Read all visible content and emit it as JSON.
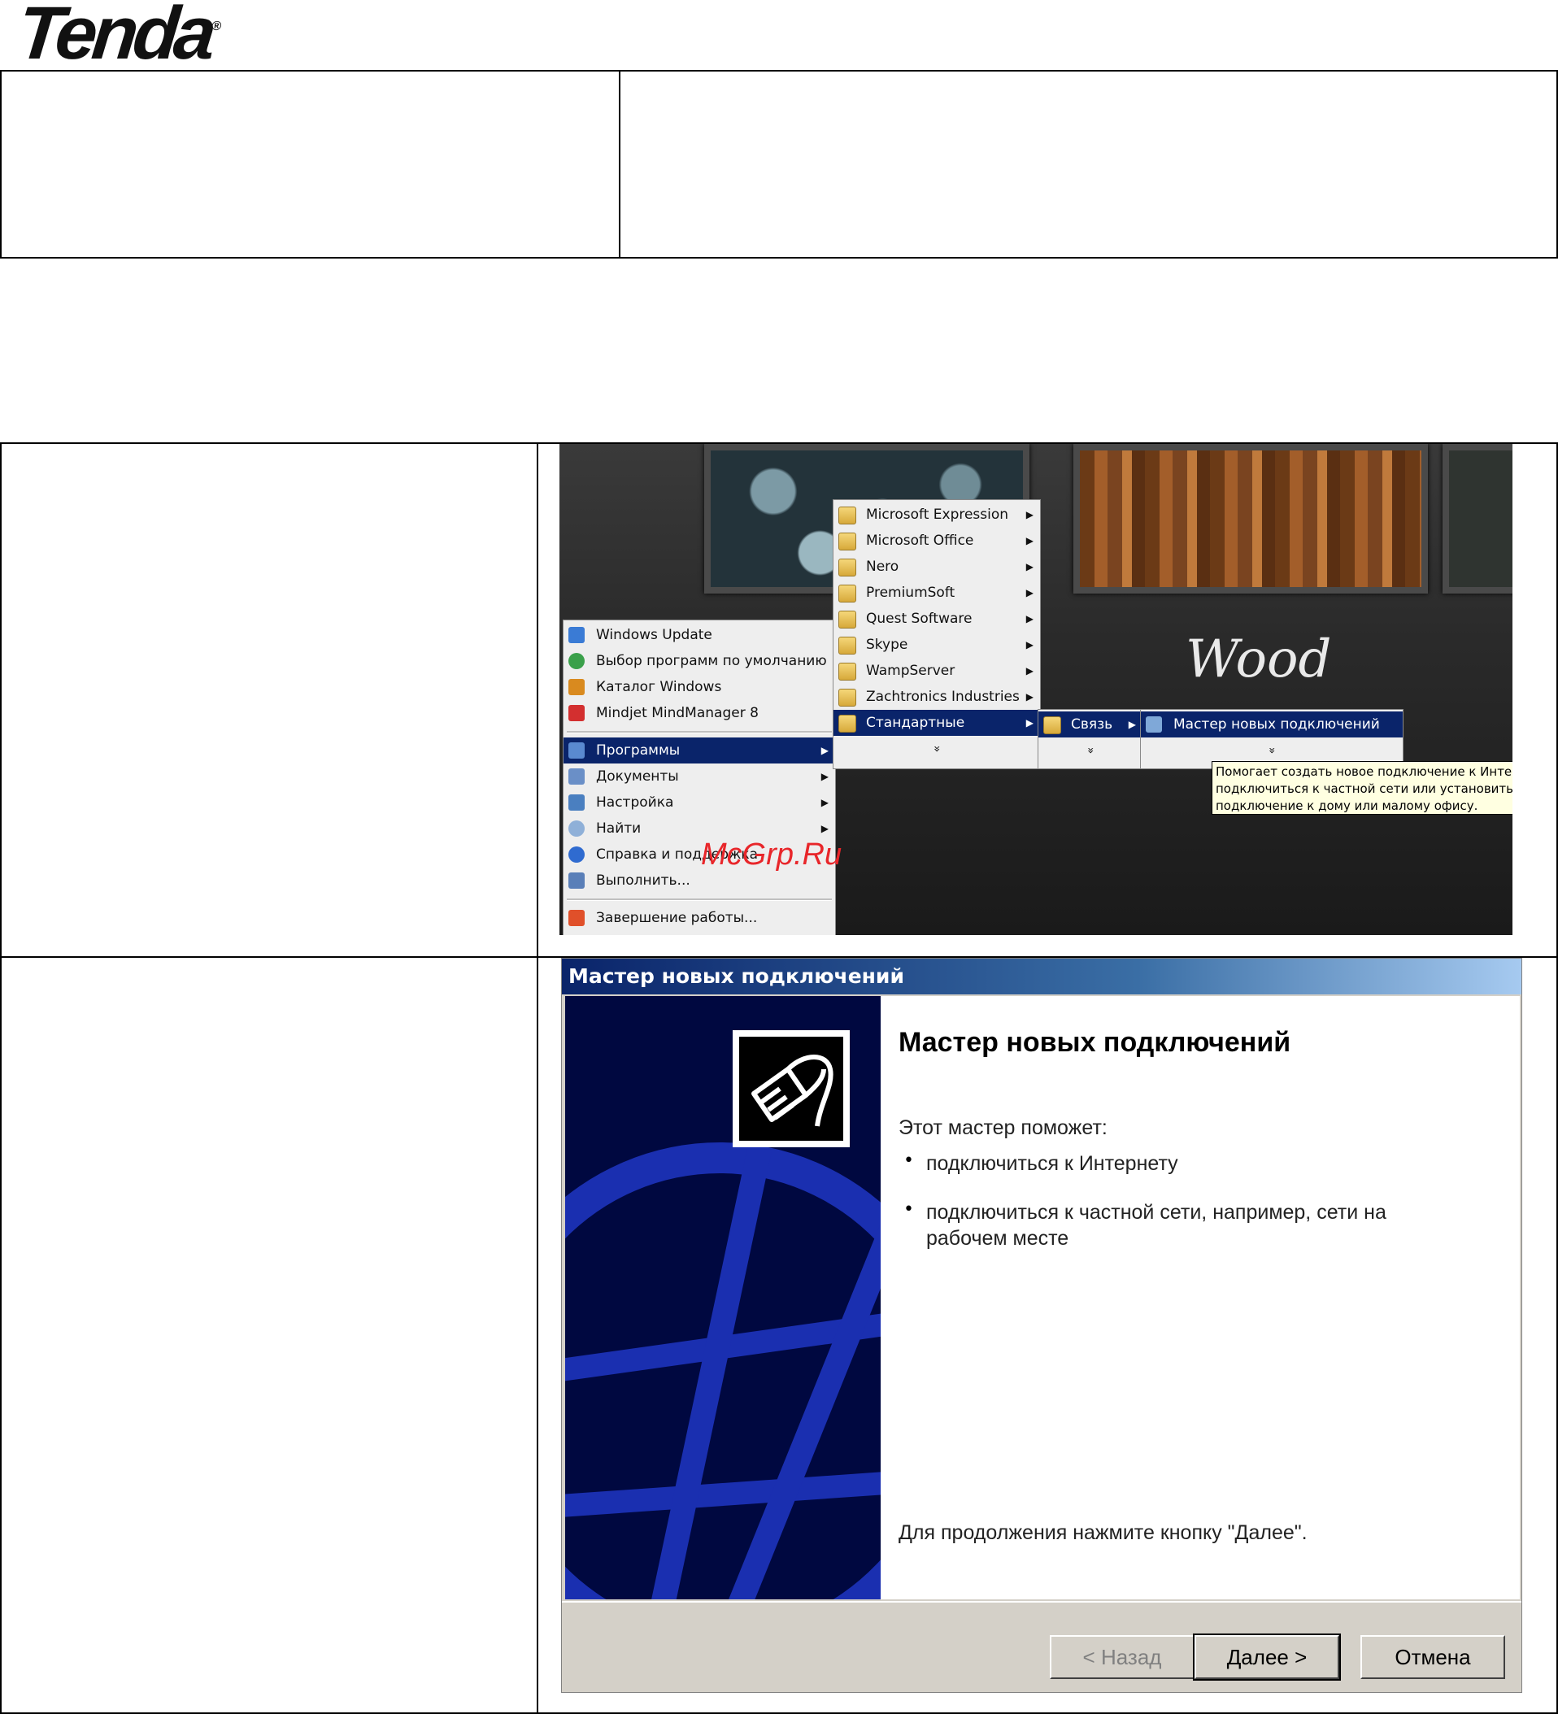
{
  "logo": {
    "text": "Tenda",
    "mark": "®"
  },
  "start_menu": {
    "top_items": [
      {
        "label": "Windows Update",
        "icon": "windows-update-icon",
        "color": "#3a7bd5"
      },
      {
        "label": "Выбор программ по умолчанию",
        "icon": "default-programs-icon",
        "color": "#3aa04a"
      },
      {
        "label": "Каталог Windows",
        "icon": "windows-catalog-icon",
        "color": "#d98a1f"
      },
      {
        "label": "Mindjet MindManager 8",
        "icon": "mindmanager-icon",
        "color": "#d32f2f"
      }
    ],
    "main_items": [
      {
        "label": "Программы",
        "icon": "programs-icon",
        "arrow": "▶"
      },
      {
        "label": "Документы",
        "icon": "documents-icon",
        "arrow": "▶"
      },
      {
        "label": "Настройка",
        "icon": "settings-icon",
        "arrow": "▶"
      },
      {
        "label": "Найти",
        "icon": "search-icon",
        "arrow": "▶"
      },
      {
        "label": "Справка и поддержка",
        "icon": "help-icon"
      },
      {
        "label": "Выполнить...",
        "icon": "run-icon"
      }
    ],
    "shutdown": "Завершение работы...",
    "programs_submenu": [
      "Microsoft Expression",
      "Microsoft Office",
      "Nero",
      "PremiumSoft",
      "Quest Software",
      "Skype",
      "WampServer",
      "Zachtronics Industries",
      "Стандартные"
    ],
    "accessories_submenu": [
      "Связь"
    ],
    "communications_submenu": [
      "Мастер новых подключений"
    ],
    "more_glyph": "»",
    "tooltip": [
      "Помогает создать новое подключение к Интернету,",
      "подключиться к частной сети или установить",
      "подключение к дому или малому офису."
    ],
    "background_text": "Wood"
  },
  "watermark": "McGrp.Ru",
  "wizard": {
    "window_title": "Мастер новых подключений",
    "heading": "Мастер новых подключений",
    "intro": "Этот мастер поможет:",
    "bullets": [
      "подключиться к Интернету",
      "подключиться к частной сети, например, сети на",
      "рабочем месте"
    ],
    "footer": "Для продолжения нажмите кнопку \"Далее\".",
    "buttons": {
      "back": "< Назад",
      "next": "Далее >",
      "cancel": "Отмена"
    }
  }
}
